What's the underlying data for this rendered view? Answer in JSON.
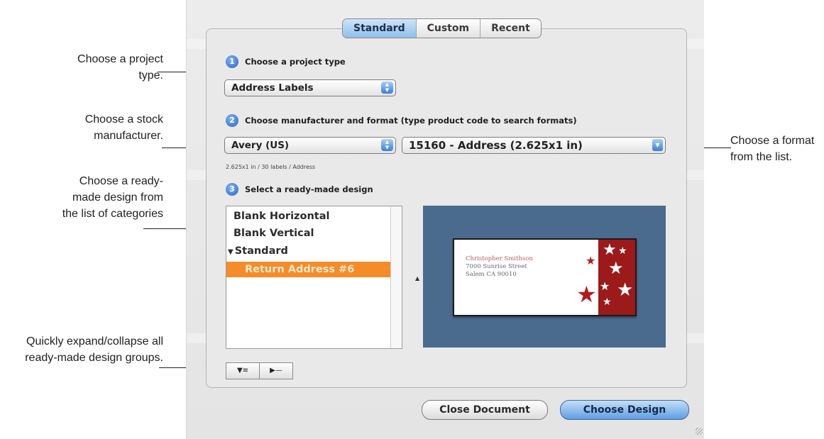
{
  "callouts": {
    "project_type": "Choose a project\ntype.",
    "stock_manufacturer": "Choose a stock\nmanufacturer.",
    "ready_made": "Choose a ready-\nmade design from\nthe list of categories",
    "expand_collapse": "Quickly expand/collapse all\nready-made design groups.",
    "format": "Choose a format\nfrom the list."
  },
  "tabs": [
    "Standard",
    "Custom",
    "Recent"
  ],
  "steps": {
    "one": {
      "num": "1",
      "label": "Choose a project type"
    },
    "two": {
      "num": "2",
      "label": "Choose manufacturer and format (type product code to search formats)"
    },
    "three": {
      "num": "3",
      "label": "Select a ready-made design"
    }
  },
  "project_type_popup": {
    "value": "Address Labels"
  },
  "manufacturer_popup": {
    "value": "Avery (US)"
  },
  "format_popup": {
    "value": "15160 - Address (2.625x1 in)"
  },
  "format_summary": "2.625x1 in / 30 labels / Address",
  "design_list": {
    "items": [
      {
        "label": "Blank Horizontal"
      },
      {
        "label": "Blank Vertical"
      },
      {
        "label": "Standard",
        "expanded": true
      },
      {
        "label": "Return Address #6",
        "selected": true
      }
    ]
  },
  "preview": {
    "name": "Christopher Smithson",
    "street": "7000 Sunrise Street",
    "city": "Salem CA 90010",
    "accent_color": "#9c1a1a",
    "background_color": "#4b6b8e"
  },
  "group_buttons": {
    "expand_icon": "▼≡",
    "collapse_icon": "▶—"
  },
  "buttons": {
    "close_document": "Close Document",
    "choose_design": "Choose Design"
  },
  "colors": {
    "selection": "#f48c2a",
    "default_button": "#5f9ee2"
  }
}
